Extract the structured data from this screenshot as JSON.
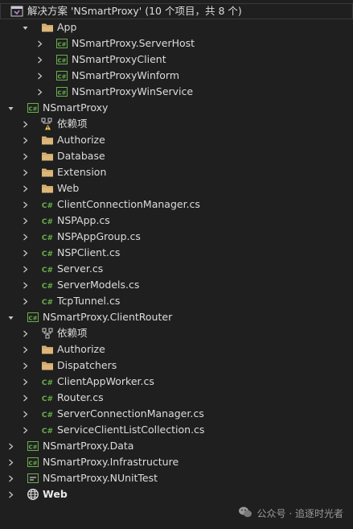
{
  "solution": {
    "label": "解决方案 'NSmartProxy' (10 个项目，共 8 个)"
  },
  "tree": [
    {
      "label": "App",
      "icon": "folder-icon",
      "expander": "expanded",
      "level": 1
    },
    {
      "label": "NSmartProxy.ServerHost",
      "icon": "csharp-project-icon",
      "expander": "collapsed",
      "level": 2
    },
    {
      "label": "NSmartProxyClient",
      "icon": "csharp-project-icon",
      "expander": "collapsed",
      "level": 2
    },
    {
      "label": "NSmartProxyWinform",
      "icon": "csharp-project-icon",
      "expander": "collapsed",
      "level": 2
    },
    {
      "label": "NSmartProxyWinService",
      "icon": "csharp-project-icon",
      "expander": "collapsed",
      "level": 2
    },
    {
      "label": "NSmartProxy",
      "icon": "csharp-project-icon",
      "expander": "expanded",
      "level": 0
    },
    {
      "label": "依赖项",
      "icon": "dependencies-warning-icon",
      "expander": "collapsed",
      "level": 1
    },
    {
      "label": "Authorize",
      "icon": "folder-icon",
      "expander": "collapsed",
      "level": 1
    },
    {
      "label": "Database",
      "icon": "folder-icon",
      "expander": "collapsed",
      "level": 1
    },
    {
      "label": "Extension",
      "icon": "folder-icon",
      "expander": "collapsed",
      "level": 1
    },
    {
      "label": "Web",
      "icon": "folder-icon",
      "expander": "collapsed",
      "level": 1
    },
    {
      "label": "ClientConnectionManager.cs",
      "icon": "csharp-file-icon",
      "expander": "collapsed",
      "level": 1
    },
    {
      "label": "NSPApp.cs",
      "icon": "csharp-file-icon",
      "expander": "collapsed",
      "level": 1
    },
    {
      "label": "NSPAppGroup.cs",
      "icon": "csharp-file-icon",
      "expander": "collapsed",
      "level": 1
    },
    {
      "label": "NSPClient.cs",
      "icon": "csharp-file-icon",
      "expander": "collapsed",
      "level": 1
    },
    {
      "label": "Server.cs",
      "icon": "csharp-file-icon",
      "expander": "collapsed",
      "level": 1
    },
    {
      "label": "ServerModels.cs",
      "icon": "csharp-file-icon",
      "expander": "collapsed",
      "level": 1
    },
    {
      "label": "TcpTunnel.cs",
      "icon": "csharp-file-icon",
      "expander": "collapsed",
      "level": 1
    },
    {
      "label": "NSmartProxy.ClientRouter",
      "icon": "csharp-project-icon",
      "expander": "expanded",
      "level": 0
    },
    {
      "label": "依赖项",
      "icon": "dependencies-icon",
      "expander": "collapsed",
      "level": 1
    },
    {
      "label": "Authorize",
      "icon": "folder-icon",
      "expander": "collapsed",
      "level": 1
    },
    {
      "label": "Dispatchers",
      "icon": "folder-icon",
      "expander": "collapsed",
      "level": 1
    },
    {
      "label": "ClientAppWorker.cs",
      "icon": "csharp-file-icon",
      "expander": "collapsed",
      "level": 1
    },
    {
      "label": "Router.cs",
      "icon": "csharp-file-icon",
      "expander": "collapsed",
      "level": 1
    },
    {
      "label": "ServerConnectionManager.cs",
      "icon": "csharp-file-icon",
      "expander": "collapsed",
      "level": 1
    },
    {
      "label": "ServiceClientListCollection.cs",
      "icon": "csharp-file-icon",
      "expander": "collapsed",
      "level": 1
    },
    {
      "label": "NSmartProxy.Data",
      "icon": "csharp-project-icon",
      "expander": "collapsed",
      "level": 0
    },
    {
      "label": "NSmartProxy.Infrastructure",
      "icon": "csharp-project-icon",
      "expander": "collapsed",
      "level": 0
    },
    {
      "label": "NSmartProxy.NUnitTest",
      "icon": "test-project-icon",
      "expander": "collapsed",
      "level": 0
    },
    {
      "label": "Web",
      "icon": "web-globe-icon",
      "expander": "collapsed",
      "level": 0,
      "bold": true
    }
  ],
  "watermark": {
    "icon": "wechat-icon",
    "text": "公众号 · 追逐时光者"
  },
  "colors": {
    "background": "#1f1f1f",
    "folder": "#dcb67a",
    "csharp": "#68b04b",
    "text": "#dcdcdc",
    "chevron": "#c8c8c8",
    "warning": "#f2c94c",
    "solution_icon": "#b180d7"
  }
}
